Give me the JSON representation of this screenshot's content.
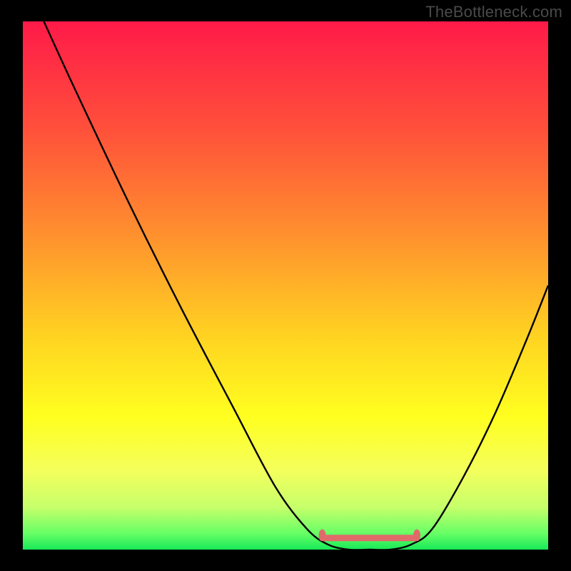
{
  "watermark": "TheBottleneck.com",
  "chart_data": {
    "type": "line",
    "title": "",
    "xlabel": "",
    "ylabel": "",
    "xlim": [
      0,
      100
    ],
    "ylim": [
      0,
      100
    ],
    "background_gradient": {
      "stops": [
        {
          "offset": 0,
          "color": "#ff1a49"
        },
        {
          "offset": 20,
          "color": "#ff4f3b"
        },
        {
          "offset": 40,
          "color": "#ff8f2e"
        },
        {
          "offset": 60,
          "color": "#ffd421"
        },
        {
          "offset": 75,
          "color": "#ffff20"
        },
        {
          "offset": 85,
          "color": "#f4ff5c"
        },
        {
          "offset": 92,
          "color": "#c6ff6a"
        },
        {
          "offset": 97,
          "color": "#66ff66"
        },
        {
          "offset": 100,
          "color": "#18e858"
        }
      ]
    },
    "series": [
      {
        "name": "bottleneck-curve",
        "color": "#000000",
        "points": [
          {
            "x": 4,
            "y": 100
          },
          {
            "x": 10,
            "y": 87
          },
          {
            "x": 20,
            "y": 66
          },
          {
            "x": 30,
            "y": 46
          },
          {
            "x": 40,
            "y": 27
          },
          {
            "x": 48,
            "y": 12
          },
          {
            "x": 54,
            "y": 4
          },
          {
            "x": 58,
            "y": 1
          },
          {
            "x": 62,
            "y": 0
          },
          {
            "x": 66,
            "y": 0
          },
          {
            "x": 70,
            "y": 0
          },
          {
            "x": 74,
            "y": 1
          },
          {
            "x": 78,
            "y": 4
          },
          {
            "x": 84,
            "y": 14
          },
          {
            "x": 90,
            "y": 26
          },
          {
            "x": 96,
            "y": 40
          },
          {
            "x": 100,
            "y": 50
          }
        ]
      }
    ],
    "flat_highlight": {
      "name": "flat-highlight",
      "color": "#e06a6a",
      "thickness": 9,
      "caps": true,
      "x_start": 57,
      "x_end": 75,
      "y": 2.2
    },
    "note": "Chart has no numeric axis labels; values above are estimated normalized coordinates (0–100) read from the image geometry. y=0 is the bottom edge of the gradient; y=100 is the top."
  }
}
